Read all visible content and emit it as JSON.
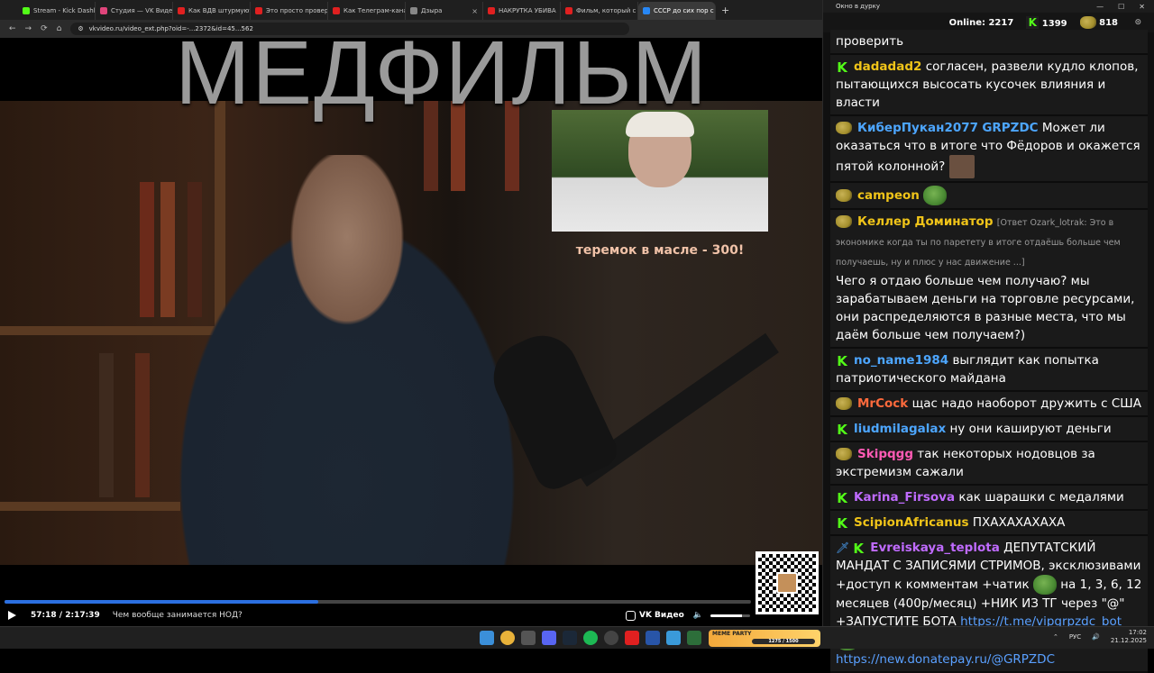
{
  "browser": {
    "tabs": [
      {
        "label": "Stream - Kick Dashb",
        "color": "#53fc18",
        "active": false
      },
      {
        "label": "Студия — VK Видео",
        "color": "#e0457b",
        "active": false
      },
      {
        "label": "Как ВДВ штурмуют",
        "color": "#e02020",
        "active": false
      },
      {
        "label": "Это просто провер",
        "color": "#e02020",
        "active": false
      },
      {
        "label": "Как Телеграм-кана",
        "color": "#e02020",
        "active": false
      },
      {
        "label": "Дзырa",
        "color": "#888888",
        "active": false
      },
      {
        "label": "НАКРУТКА УБИВА",
        "color": "#e02020",
        "active": false
      },
      {
        "label": "Фильм, который с",
        "color": "#e02020",
        "active": false
      },
      {
        "label": "СССР до сих пор с",
        "color": "#2787f5",
        "active": true
      }
    ],
    "new_tab": "+",
    "url": "vkvideo.ru/video_ext.php?oid=-...2372&id=45...562",
    "window_controls": [
      "—",
      "☐",
      "✕"
    ]
  },
  "video": {
    "title_overlay": "МЕДФИЛЬМ",
    "caption": "теремок в масле - 300!",
    "progress": 0.42,
    "time": "57:18 / 2:17:39",
    "chapter": "Чем вообще занимается НОД?",
    "brand": "VK Видео",
    "volume": 0.8
  },
  "chat": {
    "window_title": "Окно в дурку",
    "window_controls": [
      "—",
      "☐",
      "✕"
    ],
    "online_label": "Online:",
    "online_count": "2217",
    "kick_count": "1399",
    "other_count": "818",
    "messages": [
      {
        "badge": "",
        "name": "",
        "name_color": "#ffffff",
        "text": "проверить"
      },
      {
        "badge": "kick",
        "name": "dadadad2",
        "name_color": "#f0c419",
        "text": "согласен, развели кудло клопов, пытающихся высосать кусочек влияния и власти"
      },
      {
        "badge": "pepe",
        "name": "КиберПукан2077",
        "name_color": "#4da6ff",
        "mention": "GRPZDC",
        "text": "Может ли оказаться что в итоге что Фёдоров и окажется пятой колонной?"
      },
      {
        "badge": "pepe",
        "name": "campeon",
        "name_color": "#f0c419",
        "text": ""
      },
      {
        "badge": "pepe",
        "name": "Келлер Доминатор",
        "name_color": "#f0c419",
        "reply": "[Ответ Ozark_lotrak: Это в экономике когда ты по паретету в итоге отдаёшь больше чем получаешь, ну и плюс у нас движение ...]",
        "text": "Чего я отдаю больше чем получаю? мы зарабатываем деньги на торговле ресурсами, они распределяются в разные места, что мы даём больше чем получаем?)"
      },
      {
        "badge": "kick",
        "name": "no_name1984",
        "name_color": "#4da6ff",
        "text": "выглядит как попытка патриотического майдана"
      },
      {
        "badge": "pepe",
        "name": "MrCock",
        "name_color": "#ff6a3c",
        "text": "щас надо наоборот дружить с США"
      },
      {
        "badge": "kick",
        "name": "liudmilagalax",
        "name_color": "#4da6ff",
        "text": "ну они кашируют деньги"
      },
      {
        "badge": "pepe",
        "name": "Skipqgg",
        "name_color": "#ff5ab4",
        "text": "так некоторых нодовцов за экстремизм сажали"
      },
      {
        "badge": "kick",
        "name": "Karina_Firsova",
        "name_color": "#c06bff",
        "text": "как шарашки с медалями"
      },
      {
        "badge": "kick",
        "name": "ScipionAfricanus",
        "name_color": "#f0c419",
        "text": "ПХАХАХАХАХА"
      },
      {
        "badge": "kick",
        "name": "Evreiskaya_teplota",
        "name_color": "#c06bff",
        "text_a": "ДЕПУТАТСКИЙ МАНДАТ С ЗАПИСЯМИ СТРИМОВ, эксклюзивами +доступ к комментам +чатик",
        "text_b": "на 1, 3, 6, 12 месяцев (400р/месяц) +НИК ИЗ ТГ через \"@\" +ЗАПУСТИТЕ БОТА",
        "link1": "https://t.me/vipgrpzdc_bot",
        "link2": "https://new.donatepay.ru/@GRPZDC"
      }
    ]
  },
  "taskbar": {
    "meme_label": "MEME PARTY",
    "meme_progress": "1275 / 1500",
    "lang": "РУС",
    "time": "17:02",
    "date": "21.12.2025"
  }
}
